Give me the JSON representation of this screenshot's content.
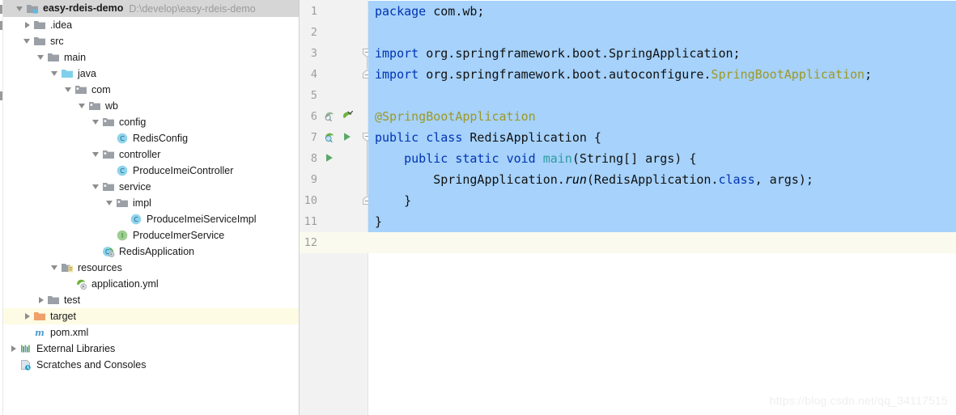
{
  "window": {
    "project_name": "easy-rdeis-demo",
    "project_path": "D:\\develop\\easy-rdeis-demo"
  },
  "project_tree": {
    "items": [
      {
        "label": "easy-rdeis-demo",
        "path": "D:\\develop\\easy-rdeis-demo",
        "icon": "module-icon",
        "depth": 0,
        "arrow": "expanded",
        "bold": true,
        "header": true
      },
      {
        "label": ".idea",
        "icon": "folder-icon",
        "depth": 1,
        "arrow": "collapsed"
      },
      {
        "label": "src",
        "icon": "folder-icon",
        "depth": 1,
        "arrow": "expanded"
      },
      {
        "label": "main",
        "icon": "folder-icon",
        "depth": 2,
        "arrow": "expanded"
      },
      {
        "label": "java",
        "icon": "source-root-icon",
        "depth": 3,
        "arrow": "expanded"
      },
      {
        "label": "com",
        "icon": "package-icon",
        "depth": 4,
        "arrow": "expanded"
      },
      {
        "label": "wb",
        "icon": "package-icon",
        "depth": 5,
        "arrow": "expanded"
      },
      {
        "label": "config",
        "icon": "package-icon",
        "depth": 6,
        "arrow": "expanded"
      },
      {
        "label": "RedisConfig",
        "icon": "java-class-icon",
        "depth": 7,
        "arrow": "none"
      },
      {
        "label": "controller",
        "icon": "package-icon",
        "depth": 6,
        "arrow": "expanded"
      },
      {
        "label": "ProduceImeiController",
        "icon": "java-class-icon",
        "depth": 7,
        "arrow": "none"
      },
      {
        "label": "service",
        "icon": "package-icon",
        "depth": 6,
        "arrow": "expanded"
      },
      {
        "label": "impl",
        "icon": "package-icon",
        "depth": 7,
        "arrow": "expanded"
      },
      {
        "label": "ProduceImeiServiceImpl",
        "icon": "java-class-icon",
        "depth": 8,
        "arrow": "none"
      },
      {
        "label": "ProduceImerService",
        "icon": "java-interface-icon",
        "depth": 7,
        "arrow": "none"
      },
      {
        "label": "RedisApplication",
        "icon": "spring-class-icon",
        "depth": 6,
        "arrow": "none"
      },
      {
        "label": "resources",
        "icon": "resource-root-icon",
        "depth": 3,
        "arrow": "expanded"
      },
      {
        "label": "application.yml",
        "icon": "spring-yaml-icon",
        "depth": 4,
        "arrow": "none"
      },
      {
        "label": "test",
        "icon": "folder-icon",
        "depth": 2,
        "arrow": "collapsed"
      },
      {
        "label": "target",
        "icon": "excluded-folder-icon",
        "depth": 1,
        "arrow": "collapsed",
        "highlight": true
      },
      {
        "label": "pom.xml",
        "icon": "maven-icon",
        "depth": 1,
        "arrow": "none"
      },
      {
        "label": "External Libraries",
        "icon": "libraries-icon",
        "depth": 0,
        "arrow": "collapsed"
      },
      {
        "label": "Scratches and Consoles",
        "icon": "scratches-icon",
        "depth": 0,
        "arrow": "none"
      }
    ]
  },
  "editor": {
    "line_numbers": [
      "1",
      "2",
      "3",
      "4",
      "5",
      "6",
      "7",
      "8",
      "9",
      "10",
      "11",
      "12"
    ],
    "caret_line": 12,
    "selection_lines": [
      1,
      2,
      3,
      4,
      5,
      6,
      7,
      8,
      9,
      10,
      11
    ],
    "lines": [
      {
        "n": 1,
        "tokens": [
          {
            "t": "package",
            "c": "kw"
          },
          {
            "t": " com.wb;",
            "c": "plain"
          }
        ]
      },
      {
        "n": 2,
        "tokens": []
      },
      {
        "n": 3,
        "tokens": [
          {
            "t": "import",
            "c": "kw"
          },
          {
            "t": " org.springframework.boot.SpringApplication;",
            "c": "plain"
          }
        ]
      },
      {
        "n": 4,
        "tokens": [
          {
            "t": "import",
            "c": "kw"
          },
          {
            "t": " org.springframework.boot.autoconfigure.",
            "c": "plain"
          },
          {
            "t": "SpringBootApplication",
            "c": "anno"
          },
          {
            "t": ";",
            "c": "plain"
          }
        ]
      },
      {
        "n": 5,
        "tokens": []
      },
      {
        "n": 6,
        "tokens": [
          {
            "t": "@SpringBootApplication",
            "c": "anno"
          }
        ]
      },
      {
        "n": 7,
        "tokens": [
          {
            "t": "public",
            "c": "kw"
          },
          {
            "t": " ",
            "c": "plain"
          },
          {
            "t": "class",
            "c": "kw"
          },
          {
            "t": " RedisApplication {",
            "c": "plain"
          }
        ]
      },
      {
        "n": 8,
        "tokens": [
          {
            "t": "    ",
            "c": "plain"
          },
          {
            "t": "public",
            "c": "kw"
          },
          {
            "t": " ",
            "c": "plain"
          },
          {
            "t": "static",
            "c": "kw"
          },
          {
            "t": " ",
            "c": "plain"
          },
          {
            "t": "void",
            "c": "kw"
          },
          {
            "t": " ",
            "c": "plain"
          },
          {
            "t": "main",
            "c": "meth"
          },
          {
            "t": "(String[] args) {",
            "c": "plain"
          }
        ]
      },
      {
        "n": 9,
        "tokens": [
          {
            "t": "        SpringApplication.",
            "c": "plain"
          },
          {
            "t": "run",
            "c": "ital"
          },
          {
            "t": "(RedisApplication.",
            "c": "plain"
          },
          {
            "t": "class",
            "c": "kw"
          },
          {
            "t": ", args);",
            "c": "plain"
          }
        ]
      },
      {
        "n": 10,
        "tokens": [
          {
            "t": "    }",
            "c": "plain"
          }
        ]
      },
      {
        "n": 11,
        "tokens": [
          {
            "t": "}",
            "c": "plain"
          }
        ]
      },
      {
        "n": 12,
        "tokens": []
      }
    ],
    "gutter_icons": [
      {
        "line": 6,
        "icons": [
          "spring-bean-inspect-icon",
          "spring-bean-checked-icon"
        ]
      },
      {
        "line": 7,
        "icons": [
          "spring-bean-icon",
          "run-icon"
        ]
      },
      {
        "line": 8,
        "icons": [
          "run-icon"
        ]
      }
    ],
    "fold_markers": [
      {
        "line": 3,
        "state": "expanded"
      },
      {
        "line": 4,
        "state": "collapsed"
      },
      {
        "line": 7,
        "state": "expanded"
      },
      {
        "line": 10,
        "state": "collapsed"
      }
    ]
  },
  "watermark": {
    "text": "https://blog.csdn.net/qq_34117515"
  },
  "colors": {
    "selection": "#a6d2fb",
    "caret_line": "#fbfaef",
    "tree_highlight": "#fdfbe3",
    "keyword": "#0033b3",
    "annotation": "#9e9822",
    "method": "#2d9ca0",
    "gutter_bg": "#f2f2f2",
    "header_bg": "#d6d6d6"
  }
}
